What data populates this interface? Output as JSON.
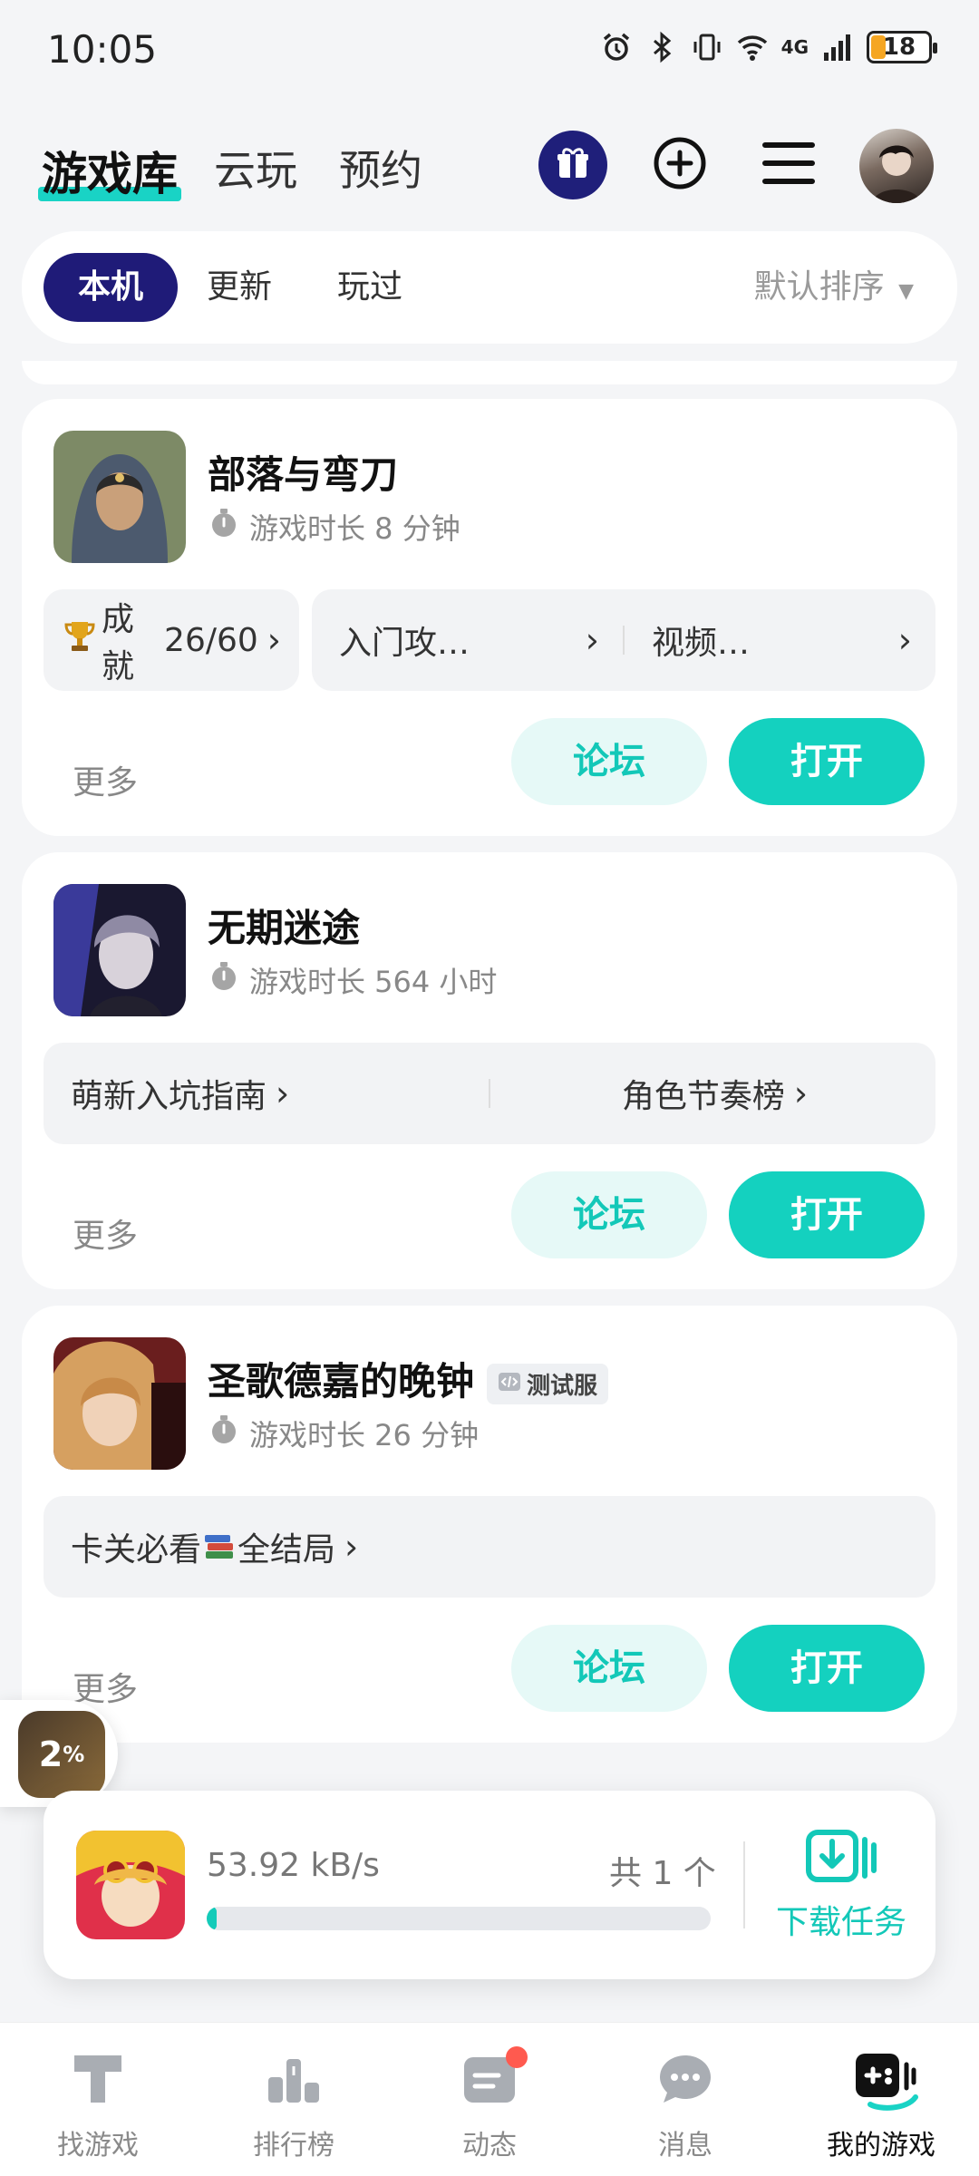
{
  "status_bar": {
    "time": "10:05",
    "network": "4G",
    "battery": "18"
  },
  "header": {
    "tabs": [
      "游戏库",
      "云玩",
      "预约"
    ]
  },
  "filters": {
    "chips": [
      "本机",
      "更新",
      "玩过"
    ],
    "sort_label": "默认排序"
  },
  "colors": {
    "accent": "#14d1bf",
    "navy": "#1f1b78",
    "forum_bg": "#e6f9f7"
  },
  "games": [
    {
      "title": "部落与弯刀",
      "time": "游戏时长 8 分钟",
      "achievement_label": "成就",
      "achievement_value": "26/60",
      "links": [
        "入门攻…",
        "视频…"
      ],
      "more": "更多",
      "forum": "论坛",
      "open": "打开"
    },
    {
      "title": "无期迷途",
      "time": "游戏时长 564 小时",
      "links": [
        "萌新入坑指南",
        "角色节奏榜"
      ],
      "more": "更多",
      "forum": "论坛",
      "open": "打开"
    },
    {
      "title": "圣歌德嘉的晚钟",
      "badge": "测试服",
      "time": "游戏时长 26 分钟",
      "links_prefix": "卡关必看",
      "links_suffix": "全结局",
      "more": "更多",
      "forum": "论坛",
      "open": "打开"
    }
  ],
  "floating": {
    "percent": "2",
    "percent_sign": "%"
  },
  "download": {
    "speed": "53.92 kB/s",
    "count": "共 1 个",
    "task_label": "下载任务",
    "progress_percent": 2
  },
  "bottom_nav": [
    "找游戏",
    "排行榜",
    "动态",
    "消息",
    "我的游戏"
  ]
}
